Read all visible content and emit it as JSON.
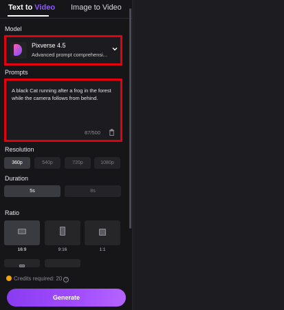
{
  "tabs": {
    "text_to_video_prefix": "Text to ",
    "text_to_video_accent": "Video",
    "image_to_video": "Image to Video"
  },
  "model": {
    "section_label": "Model",
    "name": "Pixverse 4.5",
    "description": "Advanced prompt comprehensi..."
  },
  "prompt": {
    "section_label": "Prompts",
    "value": "A black Cat running after a frog  in the forest while the camera follows from behind.",
    "counter": "87/500"
  },
  "resolution": {
    "section_label": "Resolution",
    "options": [
      "360p",
      "540p",
      "720p",
      "1080p"
    ],
    "selected": "360p"
  },
  "duration": {
    "section_label": "Duration",
    "options": [
      "5s",
      "8s"
    ],
    "selected": "5s"
  },
  "ratio": {
    "section_label": "Ratio",
    "options": [
      "16:9",
      "9:16",
      "1:1"
    ],
    "selected": "16:9"
  },
  "credits": {
    "text": "Credits required: 20"
  },
  "generate": {
    "label": "Generate"
  },
  "colors": {
    "accent": "#8b5cf6",
    "highlight": "#e3000f",
    "button": "#a24dff"
  },
  "icons": [
    "model-logo-icon",
    "chevron-down-icon",
    "trash-icon",
    "coin-icon",
    "help-icon"
  ]
}
